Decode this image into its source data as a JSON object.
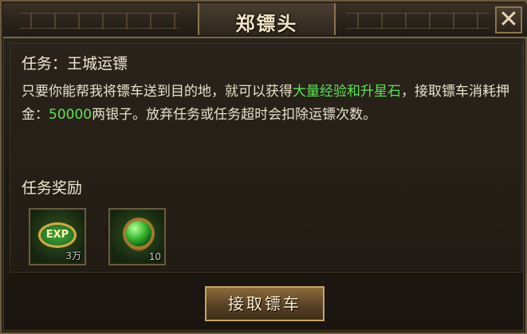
{
  "dialog": {
    "title": "郑镖头",
    "close_glyph": "✕"
  },
  "task": {
    "title": "任务：王城运镖",
    "desc_1": "只要你能帮我将镖车送到目的地，就可以获得",
    "desc_highlight": "大量经验和升星石",
    "desc_2": "，接取镖车消耗押金：",
    "deposit": "50000",
    "desc_3": "两银子。放弃任务或任务超时会扣除运镖次数。"
  },
  "rewards": {
    "label": "任务奖励",
    "items": [
      {
        "icon": "exp-icon",
        "badge": "EXP",
        "qty": "3万"
      },
      {
        "icon": "green-orb-icon",
        "qty": "10"
      }
    ]
  },
  "footer": {
    "accept_label": "接取镖车"
  },
  "colors": {
    "highlight": "#5ee25a",
    "frame": "#6b5a3e",
    "text": "#e9e0cb"
  }
}
